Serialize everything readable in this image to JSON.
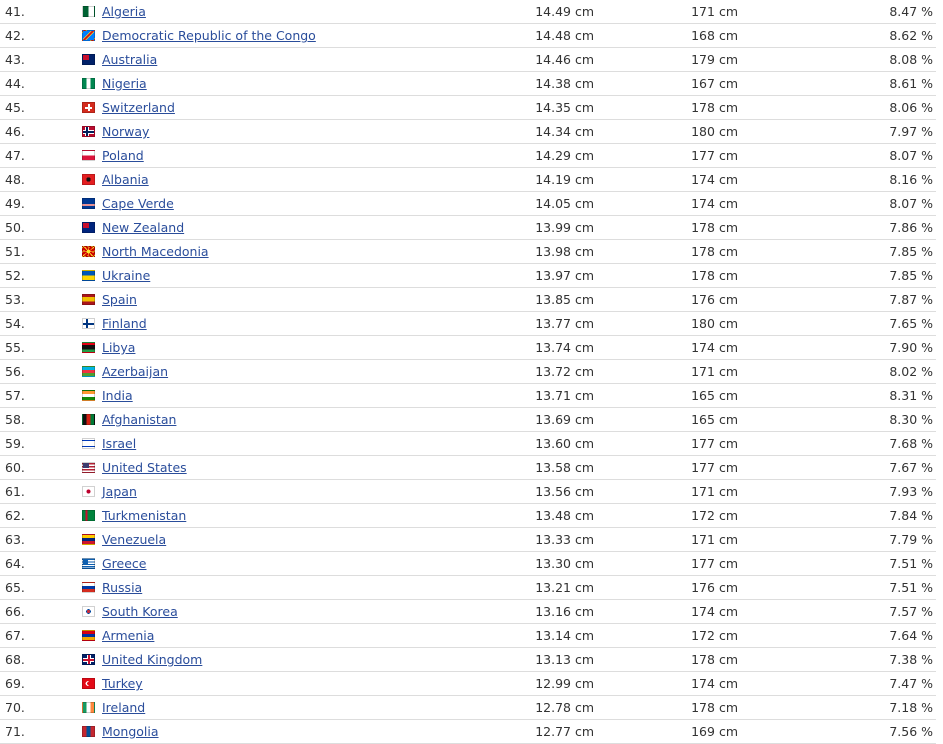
{
  "rows": [
    {
      "rank": "41.",
      "country": "Algeria",
      "length": "14.49 cm",
      "height": "171 cm",
      "ratio": "8.47 %",
      "flag": {
        "icon": "algeria-flag-icon",
        "style": "linear-gradient(90deg,#006233 50%,#ffffff 50%)"
      }
    },
    {
      "rank": "42.",
      "country": "Democratic Republic of the Congo",
      "length": "14.48 cm",
      "height": "168 cm",
      "ratio": "8.62 %",
      "flag": {
        "icon": "dr-congo-flag-icon",
        "style": "linear-gradient(135deg,#007fff 38%,#f7d618 38%,#f7d618 44%,#ce1021 44%,#ce1021 56%,#f7d618 56%,#f7d618 62%,#007fff 62%)"
      }
    },
    {
      "rank": "43.",
      "country": "Australia",
      "length": "14.46 cm",
      "height": "179 cm",
      "ratio": "8.08 %",
      "flag": {
        "icon": "australia-flag-icon",
        "style": "linear-gradient(#c8102e,#c8102e) 0 0/6px 5px no-repeat,#012169"
      }
    },
    {
      "rank": "44.",
      "country": "Nigeria",
      "length": "14.38 cm",
      "height": "167 cm",
      "ratio": "8.61 %",
      "flag": {
        "icon": "nigeria-flag-icon",
        "style": "linear-gradient(90deg,#008751 33%,#ffffff 33%,#ffffff 67%,#008751 67%)"
      }
    },
    {
      "rank": "45.",
      "country": "Switzerland",
      "length": "14.35 cm",
      "height": "178 cm",
      "ratio": "8.06 %",
      "flag": {
        "icon": "switzerland-flag-icon",
        "style": "linear-gradient(#ffffff,#ffffff) center/7px 2px no-repeat,linear-gradient(#ffffff,#ffffff) center/2px 7px no-repeat,#d52b1e"
      }
    },
    {
      "rank": "46.",
      "country": "Norway",
      "length": "14.34 cm",
      "height": "180 cm",
      "ratio": "7.97 %",
      "flag": {
        "icon": "norway-flag-icon",
        "style": "linear-gradient(#00205b,#00205b) 0 4px/100% 2px no-repeat,linear-gradient(#00205b,#00205b) 3px 0/2px 100% no-repeat,linear-gradient(#ffffff,#ffffff) 0 3px/100% 4px no-repeat,linear-gradient(#ffffff,#ffffff) 2px 0/4px 100% no-repeat,#ba0c2f"
      }
    },
    {
      "rank": "47.",
      "country": "Poland",
      "length": "14.29 cm",
      "height": "177 cm",
      "ratio": "8.07 %",
      "flag": {
        "icon": "poland-flag-icon",
        "style": "linear-gradient(#ffffff 50%,#dc143c 50%)"
      }
    },
    {
      "rank": "48.",
      "country": "Albania",
      "length": "14.19 cm",
      "height": "174 cm",
      "ratio": "8.16 %",
      "flag": {
        "icon": "albania-flag-icon",
        "style": "radial-gradient(circle,#111111 30%,#e41e20 32%)"
      }
    },
    {
      "rank": "49.",
      "country": "Cape Verde",
      "length": "14.05 cm",
      "height": "174 cm",
      "ratio": "8.07 %",
      "flag": {
        "icon": "cape-verde-flag-icon",
        "style": "linear-gradient(#003893 55%,#ffffff 55%,#ffffff 62%,#cf2027 62%,#cf2027 70%,#ffffff 70%,#ffffff 77%,#003893 77%)"
      }
    },
    {
      "rank": "50.",
      "country": "New Zealand",
      "length": "13.99 cm",
      "height": "178 cm",
      "ratio": "7.86 %",
      "flag": {
        "icon": "new-zealand-flag-icon",
        "style": "linear-gradient(#c8102e,#c8102e) 0 0/6px 5px no-repeat,#00247d"
      }
    },
    {
      "rank": "51.",
      "country": "North Macedonia",
      "length": "13.98 cm",
      "height": "178 cm",
      "ratio": "7.85 %",
      "flag": {
        "icon": "north-macedonia-flag-icon",
        "style": "radial-gradient(circle,#f8e92e 25%,transparent 27%),repeating-conic-gradient(from 0deg at 50% 50%,#f8e92e 0deg 12deg,#d20000 12deg 45deg)"
      }
    },
    {
      "rank": "52.",
      "country": "Ukraine",
      "length": "13.97 cm",
      "height": "178 cm",
      "ratio": "7.85 %",
      "flag": {
        "icon": "ukraine-flag-icon",
        "style": "linear-gradient(#0057b7 50%,#ffd700 50%)"
      }
    },
    {
      "rank": "53.",
      "country": "Spain",
      "length": "13.85 cm",
      "height": "176 cm",
      "ratio": "7.87 %",
      "flag": {
        "icon": "spain-flag-icon",
        "style": "linear-gradient(#aa151b 25%,#f1bf00 25%,#f1bf00 75%,#aa151b 75%)"
      }
    },
    {
      "rank": "54.",
      "country": "Finland",
      "length": "13.77 cm",
      "height": "180 cm",
      "ratio": "7.65 %",
      "flag": {
        "icon": "finland-flag-icon",
        "style": "linear-gradient(#003580,#003580) 0 4px/100% 2px no-repeat,linear-gradient(#003580,#003580) 3px 0/2px 100% no-repeat,#ffffff"
      }
    },
    {
      "rank": "55.",
      "country": "Libya",
      "length": "13.74 cm",
      "height": "174 cm",
      "ratio": "7.90 %",
      "flag": {
        "icon": "libya-flag-icon",
        "style": "linear-gradient(#e70013 25%,#111111 25%,#111111 75%,#239e46 75%)"
      }
    },
    {
      "rank": "56.",
      "country": "Azerbaijan",
      "length": "13.72 cm",
      "height": "171 cm",
      "ratio": "8.02 %",
      "flag": {
        "icon": "azerbaijan-flag-icon",
        "style": "linear-gradient(#00b5e2 33%,#ef3340 33%,#ef3340 67%,#509e2f 67%)"
      }
    },
    {
      "rank": "57.",
      "country": "India",
      "length": "13.71 cm",
      "height": "165 cm",
      "ratio": "8.31 %",
      "flag": {
        "icon": "india-flag-icon",
        "style": "linear-gradient(#ff9933 33%,#ffffff 33%,#ffffff 67%,#138808 67%)"
      }
    },
    {
      "rank": "58.",
      "country": "Afghanistan",
      "length": "13.69 cm",
      "height": "165 cm",
      "ratio": "8.30 %",
      "flag": {
        "icon": "afghanistan-flag-icon",
        "style": "linear-gradient(90deg,#111111 33%,#d32011 33%,#d32011 67%,#007a36 67%)"
      }
    },
    {
      "rank": "59.",
      "country": "Israel",
      "length": "13.60 cm",
      "height": "177 cm",
      "ratio": "7.68 %",
      "flag": {
        "icon": "israel-flag-icon",
        "style": "linear-gradient(#ffffff 12%,#0038b8 12%,#0038b8 24%,#ffffff 24%,#ffffff 76%,#0038b8 76%,#0038b8 88%,#ffffff 88%)"
      }
    },
    {
      "rank": "60.",
      "country": "United States",
      "length": "13.58 cm",
      "height": "177 cm",
      "ratio": "7.67 %",
      "flag": {
        "icon": "united-states-flag-icon",
        "style": "linear-gradient(#3c3b6e,#3c3b6e) 0 0/6px 5px no-repeat,repeating-linear-gradient(#b22234 0px,#b22234 1.5px,#ffffff 1.5px,#ffffff 3px)"
      }
    },
    {
      "rank": "61.",
      "country": "Japan",
      "length": "13.56 cm",
      "height": "171 cm",
      "ratio": "7.93 %",
      "flag": {
        "icon": "japan-flag-icon",
        "style": "radial-gradient(circle,#bc002d 28%,#ffffff 30%)"
      }
    },
    {
      "rank": "62.",
      "country": "Turkmenistan",
      "length": "13.48 cm",
      "height": "172 cm",
      "ratio": "7.84 %",
      "flag": {
        "icon": "turkmenistan-flag-icon",
        "style": "linear-gradient(90deg,#00843d 22%,#c8102e 22%,#c8102e 40%,#00843d 40%)"
      }
    },
    {
      "rank": "63.",
      "country": "Venezuela",
      "length": "13.33 cm",
      "height": "171 cm",
      "ratio": "7.79 %",
      "flag": {
        "icon": "venezuela-flag-icon",
        "style": "linear-gradient(#ffcc00 33%,#00247d 33%,#00247d 67%,#cf142b 67%)"
      }
    },
    {
      "rank": "64.",
      "country": "Greece",
      "length": "13.30 cm",
      "height": "177 cm",
      "ratio": "7.51 %",
      "flag": {
        "icon": "greece-flag-icon",
        "style": "linear-gradient(#0d5eaf,#0d5eaf) 0 0/5px 5px no-repeat,repeating-linear-gradient(#0d5eaf 0px,#0d5eaf 1.2px,#ffffff 1.2px,#ffffff 2.4px)"
      }
    },
    {
      "rank": "65.",
      "country": "Russia",
      "length": "13.21 cm",
      "height": "176 cm",
      "ratio": "7.51 %",
      "flag": {
        "icon": "russia-flag-icon",
        "style": "linear-gradient(#ffffff 33%,#0039a6 33%,#0039a6 67%,#d52b1e 67%)"
      }
    },
    {
      "rank": "66.",
      "country": "South Korea",
      "length": "13.16 cm",
      "height": "174 cm",
      "ratio": "7.57 %",
      "flag": {
        "icon": "south-korea-flag-icon",
        "style": "radial-gradient(circle,#cd2e3a 0,#cd2e3a 22%,#0047a0 22%,#0047a0 32%,#ffffff 34%)"
      }
    },
    {
      "rank": "67.",
      "country": "Armenia",
      "length": "13.14 cm",
      "height": "172 cm",
      "ratio": "7.64 %",
      "flag": {
        "icon": "armenia-flag-icon",
        "style": "linear-gradient(#d90012 33%,#0033a0 33%,#0033a0 67%,#f2a800 67%)"
      }
    },
    {
      "rank": "68.",
      "country": "United Kingdom",
      "length": "13.13 cm",
      "height": "178 cm",
      "ratio": "7.38 %",
      "flag": {
        "icon": "united-kingdom-flag-icon",
        "style": "linear-gradient(#c8102e,#c8102e) 0 4px/100% 2px no-repeat,linear-gradient(#c8102e,#c8102e) 5px 0/2px 100% no-repeat,linear-gradient(#ffffff,#ffffff) 0 3px/100% 4px no-repeat,linear-gradient(#ffffff,#ffffff) 4px 0/4px 100% no-repeat,#012169"
      }
    },
    {
      "rank": "69.",
      "country": "Turkey",
      "length": "12.99 cm",
      "height": "174 cm",
      "ratio": "7.47 %",
      "flag": {
        "icon": "turkey-flag-icon",
        "style": "radial-gradient(circle at 55% 50%,#e30a17 24%,transparent 26%),radial-gradient(circle at 45% 50%,#ffffff 30%,#e30a17 32%)"
      }
    },
    {
      "rank": "70.",
      "country": "Ireland",
      "length": "12.78 cm",
      "height": "178 cm",
      "ratio": "7.18 %",
      "flag": {
        "icon": "ireland-flag-icon",
        "style": "linear-gradient(90deg,#169b62 33%,#ffffff 33%,#ffffff 67%,#ff883e 67%)"
      }
    },
    {
      "rank": "71.",
      "country": "Mongolia",
      "length": "12.77 cm",
      "height": "169 cm",
      "ratio": "7.56 %",
      "flag": {
        "icon": "mongolia-flag-icon",
        "style": "linear-gradient(90deg,#c4272f 33%,#015197 33%,#015197 67%,#c4272f 67%)"
      }
    }
  ]
}
